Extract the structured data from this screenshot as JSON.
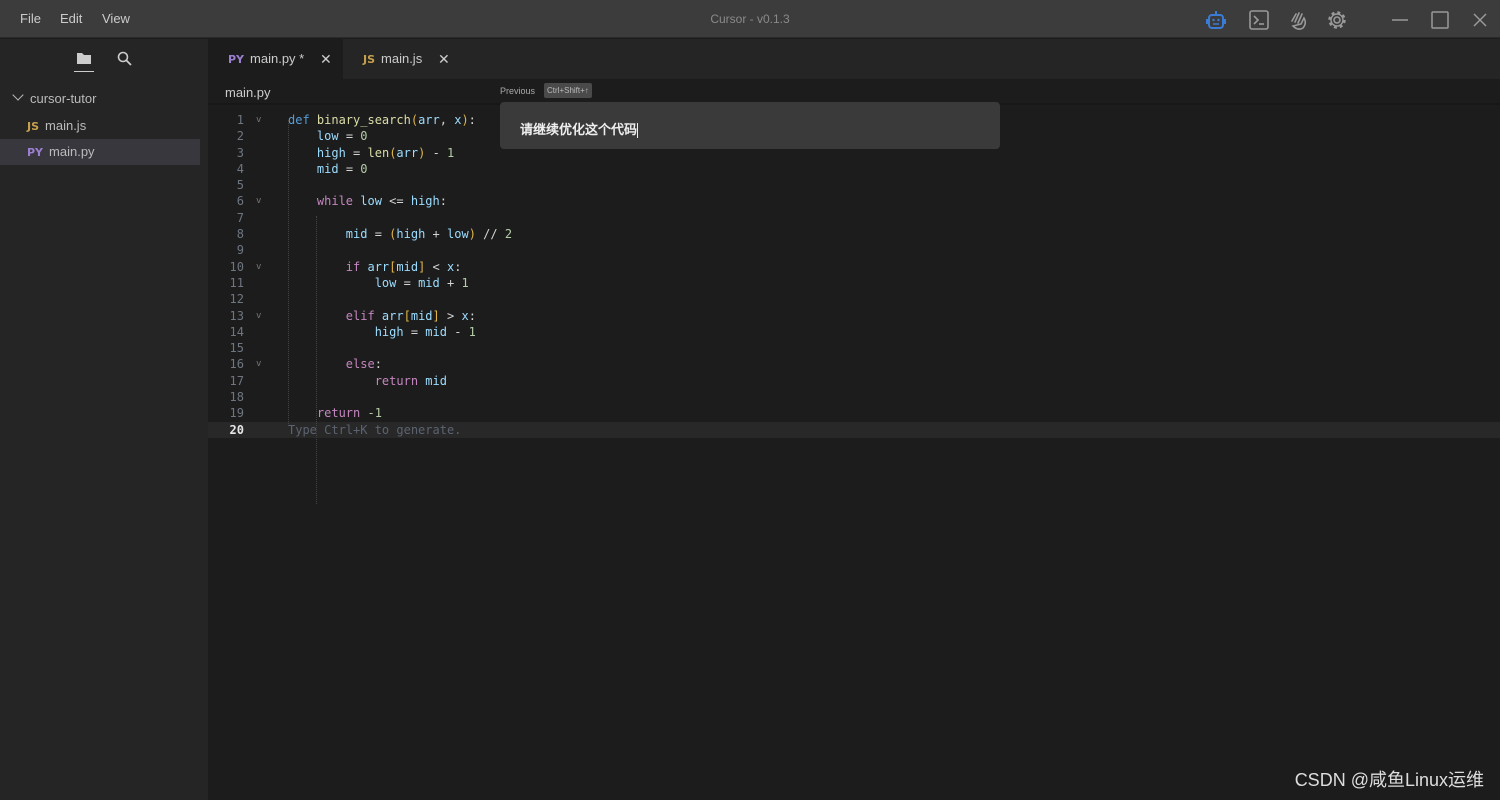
{
  "menu": [
    "File",
    "Edit",
    "View"
  ],
  "title": "Cursor - v0.1.3",
  "titlebar_icons": [
    "robot-icon",
    "terminal-icon",
    "hand-wave-icon",
    "gear-icon",
    "minimize-icon",
    "maximize-icon",
    "close-icon"
  ],
  "accent": "#3a7bd5",
  "sidebar": {
    "folder": "cursor-tutor",
    "files": [
      {
        "badge": "JS",
        "name": "main.js"
      },
      {
        "badge": "PY",
        "name": "main.py",
        "active": true
      }
    ]
  },
  "tabs": [
    {
      "badge": "PY",
      "label": "main.py *",
      "active": true
    },
    {
      "badge": "JS",
      "label": "main.js"
    }
  ],
  "breadcrumb": "main.py",
  "prompt": {
    "previous": "Previous",
    "shortcut": "Ctrl+Shift+↑",
    "value": "请继续优化这个代码"
  },
  "code": [
    [
      [
        "k",
        "def "
      ],
      [
        "f",
        "binary_search"
      ],
      [
        "b",
        "("
      ],
      [
        "v",
        "arr"
      ],
      [
        "p",
        ", "
      ],
      [
        "v",
        "x"
      ],
      [
        "b",
        ")"
      ],
      [
        "p",
        ":"
      ]
    ],
    [
      [
        "p",
        "    "
      ],
      [
        "v",
        "low"
      ],
      [
        "p",
        " = "
      ],
      [
        "n",
        "0"
      ]
    ],
    [
      [
        "p",
        "    "
      ],
      [
        "v",
        "high"
      ],
      [
        "p",
        " = "
      ],
      [
        "f",
        "len"
      ],
      [
        "b",
        "("
      ],
      [
        "v",
        "arr"
      ],
      [
        "b",
        ")"
      ],
      [
        "p",
        " - "
      ],
      [
        "n",
        "1"
      ]
    ],
    [
      [
        "p",
        "    "
      ],
      [
        "v",
        "mid"
      ],
      [
        "p",
        " = "
      ],
      [
        "n",
        "0"
      ]
    ],
    [],
    [
      [
        "p",
        "    "
      ],
      [
        "c",
        "while "
      ],
      [
        "v",
        "low"
      ],
      [
        "p",
        " <= "
      ],
      [
        "v",
        "high"
      ],
      [
        "p",
        ":"
      ]
    ],
    [],
    [
      [
        "p",
        "        "
      ],
      [
        "v",
        "mid"
      ],
      [
        "p",
        " = "
      ],
      [
        "b",
        "("
      ],
      [
        "v",
        "high"
      ],
      [
        "p",
        " + "
      ],
      [
        "v",
        "low"
      ],
      [
        "b",
        ")"
      ],
      [
        "p",
        " // "
      ],
      [
        "n",
        "2"
      ]
    ],
    [],
    [
      [
        "p",
        "        "
      ],
      [
        "c",
        "if "
      ],
      [
        "v",
        "arr"
      ],
      [
        "b",
        "["
      ],
      [
        "v",
        "mid"
      ],
      [
        "b",
        "]"
      ],
      [
        "p",
        " < "
      ],
      [
        "v",
        "x"
      ],
      [
        "p",
        ":"
      ]
    ],
    [
      [
        "p",
        "            "
      ],
      [
        "v",
        "low"
      ],
      [
        "p",
        " = "
      ],
      [
        "v",
        "mid"
      ],
      [
        "p",
        " + "
      ],
      [
        "n",
        "1"
      ]
    ],
    [],
    [
      [
        "p",
        "        "
      ],
      [
        "c",
        "elif "
      ],
      [
        "v",
        "arr"
      ],
      [
        "b",
        "["
      ],
      [
        "v",
        "mid"
      ],
      [
        "b",
        "]"
      ],
      [
        "p",
        " > "
      ],
      [
        "v",
        "x"
      ],
      [
        "p",
        ":"
      ]
    ],
    [
      [
        "p",
        "            "
      ],
      [
        "v",
        "high"
      ],
      [
        "p",
        " = "
      ],
      [
        "v",
        "mid"
      ],
      [
        "p",
        " - "
      ],
      [
        "n",
        "1"
      ]
    ],
    [],
    [
      [
        "p",
        "        "
      ],
      [
        "c",
        "else"
      ],
      [
        "p",
        ":"
      ]
    ],
    [
      [
        "p",
        "            "
      ],
      [
        "c",
        "return "
      ],
      [
        "v",
        "mid"
      ]
    ],
    [],
    [
      [
        "p",
        "    "
      ],
      [
        "c",
        "return "
      ],
      [
        "n",
        "-1"
      ]
    ],
    [
      [
        "h",
        "Type Ctrl+K to generate."
      ]
    ]
  ],
  "fold_lines": [
    1,
    6,
    10,
    13,
    16
  ],
  "current_line": 20,
  "watermark": "CSDN @咸鱼Linux运维"
}
